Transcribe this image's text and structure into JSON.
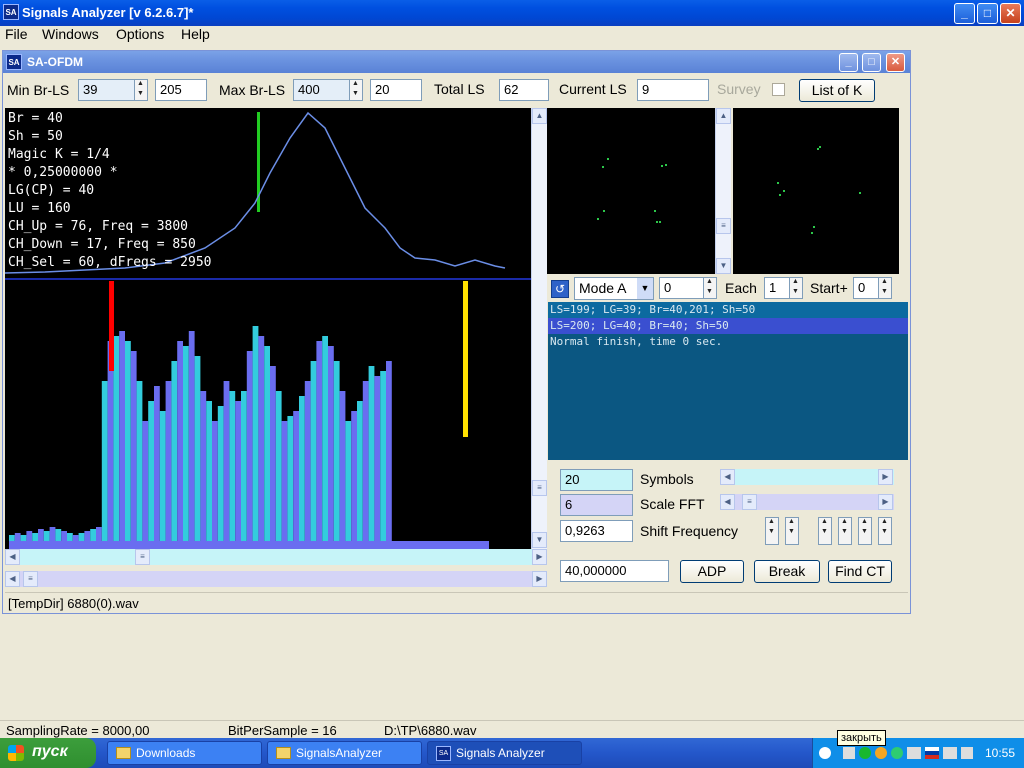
{
  "app": {
    "title": "Signals Analyzer [v 6.2.6.7]*",
    "icon": "SA"
  },
  "menu": [
    "File",
    "Windows",
    "Options",
    "Help"
  ],
  "child": {
    "title": "SA-OFDM",
    "min_br_ls_label": "Min Br-LS",
    "min_br_ls_value": "39",
    "min_br_ls_value2": "205",
    "max_br_ls_label": "Max Br-LS",
    "max_br_ls_value": "400",
    "max_br_ls_value2": "20",
    "total_ls_label": "Total LS",
    "total_ls_value": "62",
    "current_ls_label": "Current LS",
    "current_ls_value": "9",
    "survey_label": "Survey",
    "list_of_k_label": "List of K",
    "info_lines": [
      "Br = 40",
      "Sh = 50",
      "Magic K = 1/4",
      "* 0,25000000 *",
      "LG(CP) = 40",
      "LU = 160",
      "CH_Up = 76, Freq = 3800",
      "CH_Down = 17, Freq = 850",
      "CH_Sel = 60, dFregs = 2950"
    ],
    "mode_label": "Mode A",
    "mode_value": "0",
    "each_label": "Each",
    "each_value": "1",
    "start_label": "Start+",
    "start_value": "0",
    "log_lines": [
      "LS=199; LG=39; Br=40,201; Sh=50",
      "LS=200; LG=40; Br=40; Sh=50",
      "Normal finish, time 0 sec."
    ],
    "symbols_value": "20",
    "symbols_label": "Symbols",
    "scale_fft_value": "6",
    "scale_fft_label": "Scale FFT",
    "shift_freq_value": "0,9263",
    "shift_freq_label": "Shift Frequency",
    "freq_value": "40,000000",
    "adp_label": "ADP",
    "break_label": "Break",
    "find_ct_label": "Find CT",
    "status": "[TempDir] 6880(0).wav"
  },
  "colors": {
    "bar_a": "#33ccdd",
    "bar_b": "#6a6df0",
    "curve": "#6b8ee6",
    "marker_red": "#ff0000",
    "marker_yellow": "#ffe000",
    "marker_green": "#22cc22"
  },
  "statusbar": {
    "sampling": "SamplingRate = 8000,00",
    "bits": "BitPerSample = 16",
    "file": "D:\\TP\\6880.wav"
  },
  "taskbar": {
    "start": "пуск",
    "tasks": [
      "Downloads",
      "SignalsAnalyzer",
      "Signals Analyzer"
    ],
    "tray_tooltip": "закрыть",
    "time": "10:55"
  }
}
